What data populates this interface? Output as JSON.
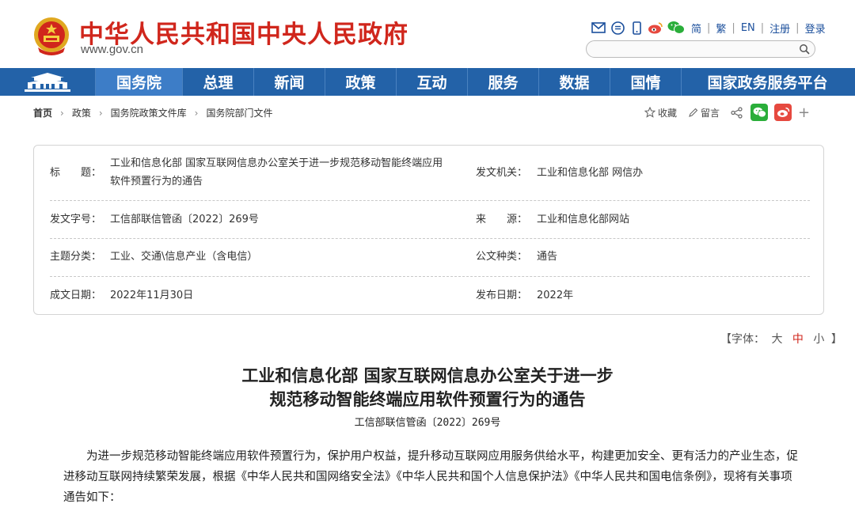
{
  "site": {
    "title": "中华人民共和国中央人民政府",
    "url": "www.gov.cn"
  },
  "top_tools": {
    "lang_simplified": "简",
    "lang_traditional": "繁",
    "lang_english": "EN",
    "register": "注册",
    "login": "登录",
    "separator": "|",
    "search_placeholder": ""
  },
  "nav": {
    "items": [
      "国务院",
      "总理",
      "新闻",
      "政策",
      "互动",
      "服务",
      "数据",
      "国情",
      "国家政务服务平台"
    ]
  },
  "breadcrumb": {
    "items": [
      "首页",
      "政策",
      "国务院政策文件库",
      "国务院部门文件"
    ],
    "arrow": "›"
  },
  "actions": {
    "favorite": "收藏",
    "comment": "留言",
    "plus": "+"
  },
  "info": {
    "title_label": "标　　题：",
    "title_value_line1": "工业和信息化部 国家互联网信息办公室关于进一步规范移动智能终端应用",
    "title_value_line2": "软件预置行为的通告",
    "issuer_label": "发文机关：",
    "issuer_value": "工业和信息化部 网信办",
    "docno_label": "发文字号：",
    "docno_value": "工信部联信管函〔2022〕269号",
    "source_label": "来　　源：",
    "source_value": "工业和信息化部网站",
    "topic_label": "主题分类：",
    "topic_value": "工业、交通\\信息产业（含电信）",
    "doctype_label": "公文种类：",
    "doctype_value": "通告",
    "written_label": "成文日期：",
    "written_value": "2022年11月30日",
    "published_label": "发布日期：",
    "published_value": "2022年"
  },
  "fontsize": {
    "prefix": "【字体：",
    "large": "大",
    "medium": "中",
    "small": "小",
    "suffix": "】"
  },
  "article": {
    "title_line1": "工业和信息化部 国家互联网信息办公室关于进一步",
    "title_line2": "规范移动智能终端应用软件预置行为的通告",
    "doc_no": "工信部联信管函〔2022〕269号",
    "paragraph": "为进一步规范移动智能终端应用软件预置行为，保护用户权益，提升移动互联网应用服务供给水平，构建更加安全、更有活力的产业生态，促进移动互联网持续繁荣发展，根据《中华人民共和国网络安全法》《中华人民共和国个人信息保护法》《中华人民共和国电信条例》，现将有关事项通告如下："
  },
  "colors": {
    "brand_red": "#d0261c",
    "nav_blue": "#2362a8",
    "nav_active": "#3d7dc7",
    "link_blue": "#1b4f9c"
  },
  "icons": [
    "national-emblem-icon",
    "mail-icon",
    "message-icon",
    "mobile-icon",
    "weibo-icon",
    "wechat-icon",
    "search-icon",
    "star-icon",
    "pen-icon",
    "share-icon"
  ]
}
